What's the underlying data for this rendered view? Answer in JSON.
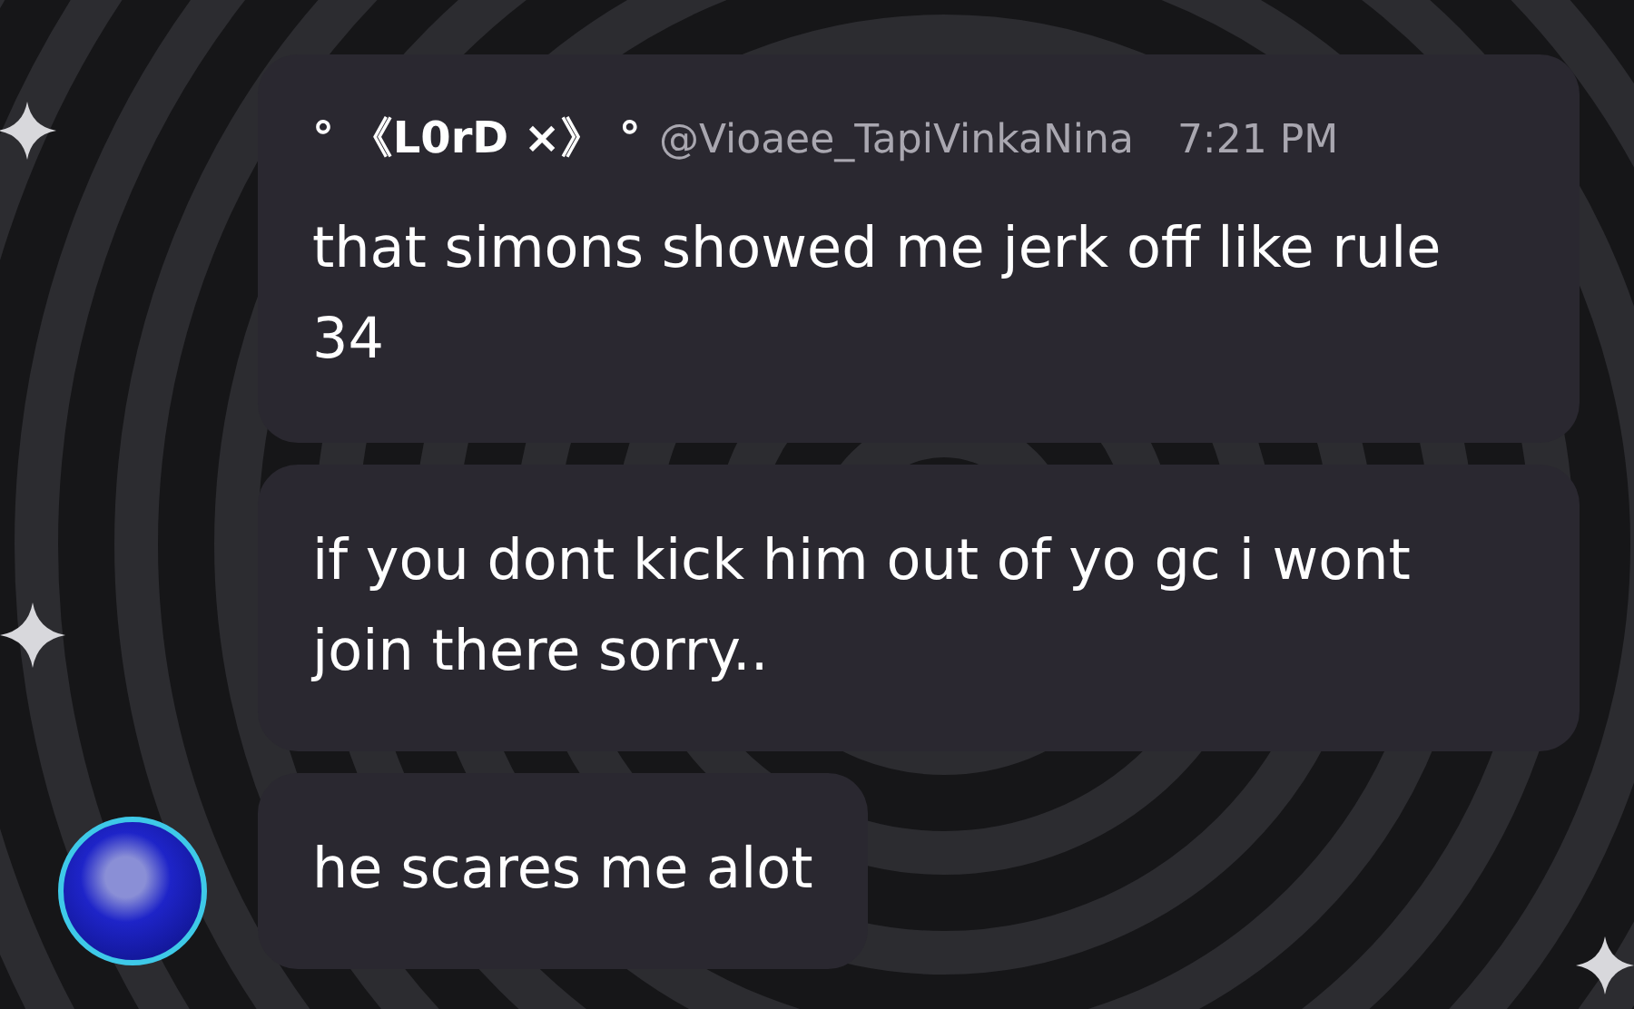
{
  "author": {
    "display_name": "° 《L0rD ×》 °",
    "handle": "@Vioaee_TapiVinkaNina",
    "time": "7:21 PM"
  },
  "messages": [
    {
      "text": "that simons showed me jerk off like rule 34"
    },
    {
      "text": "if you dont kick him out of yo gc i wont join there sorry.."
    },
    {
      "text": "he scares me alot"
    }
  ]
}
